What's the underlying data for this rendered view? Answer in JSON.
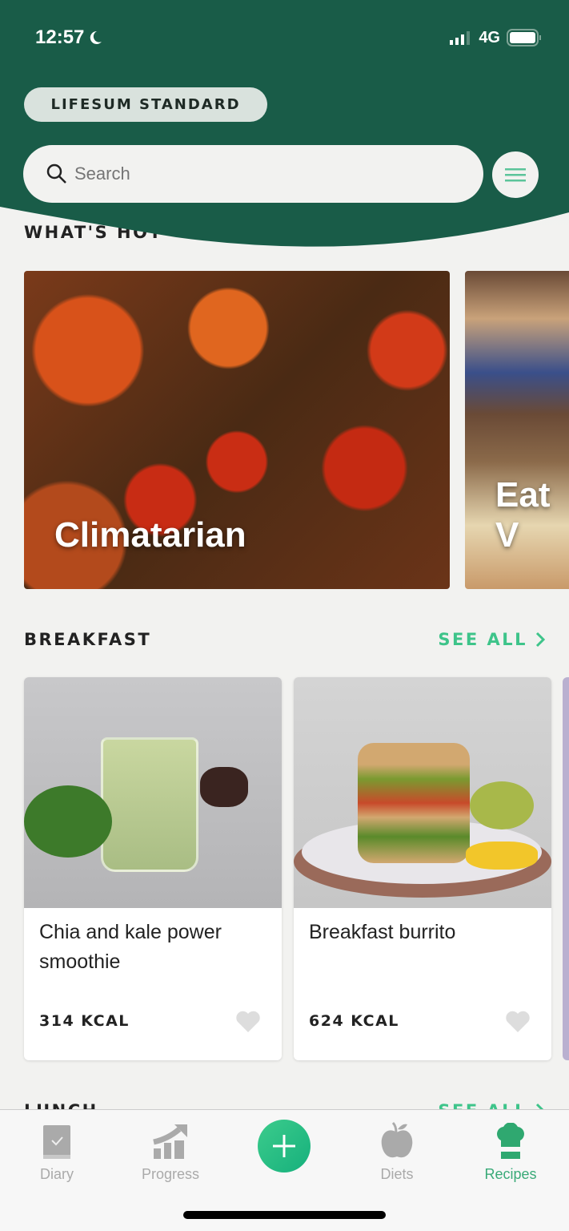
{
  "status_bar": {
    "time": "12:57",
    "network": "4G",
    "icons": [
      "moon-icon",
      "signal-icon",
      "battery-icon"
    ]
  },
  "header": {
    "plan_badge": "LIFESUM STANDARD",
    "search": {
      "placeholder": "Search",
      "value": ""
    },
    "menu_icon": "menu-icon"
  },
  "sections": {
    "whats_hot": {
      "title": "WHAT'S HOT",
      "items": [
        {
          "label": "Climatarian"
        },
        {
          "label": "Eat V"
        }
      ]
    },
    "breakfast": {
      "title": "BREAKFAST",
      "see_all": "SEE ALL",
      "items": [
        {
          "name": "Chia and kale power smoothie",
          "kcal": "314 KCAL"
        },
        {
          "name": "Breakfast burrito",
          "kcal": "624 KCAL"
        }
      ]
    },
    "lunch": {
      "title": "LUNCH",
      "see_all": "SEE ALL"
    }
  },
  "tabbar": {
    "items": [
      {
        "label": "Diary"
      },
      {
        "label": "Progress"
      },
      {
        "label": "Diets"
      },
      {
        "label": "Recipes",
        "active": true
      }
    ]
  },
  "colors": {
    "header": "#195c48",
    "accent": "#3ec48a",
    "active_tab": "#3aaa78"
  }
}
